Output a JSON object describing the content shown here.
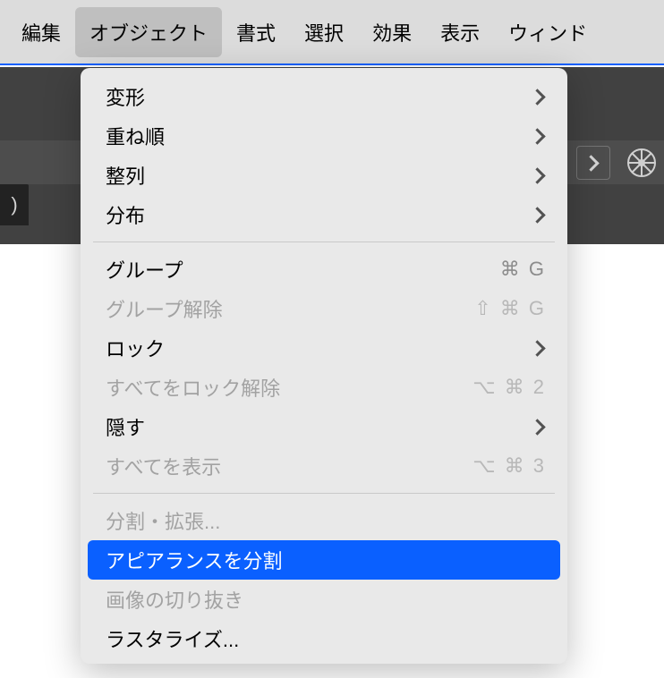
{
  "menubar": {
    "items": [
      {
        "label": "編集"
      },
      {
        "label": "オブジェクト"
      },
      {
        "label": "書式"
      },
      {
        "label": "選択"
      },
      {
        "label": "効果"
      },
      {
        "label": "表示"
      },
      {
        "label": "ウィンド"
      }
    ],
    "active_index": 1
  },
  "tab_fragment": ")",
  "dropdown": {
    "items": [
      {
        "label": "変形",
        "submenu": true
      },
      {
        "label": "重ね順",
        "submenu": true
      },
      {
        "label": "整列",
        "submenu": true
      },
      {
        "label": "分布",
        "submenu": true
      },
      {
        "sep": true
      },
      {
        "label": "グループ",
        "shortcut": "⌘ G"
      },
      {
        "label": "グループ解除",
        "shortcut": "⇧ ⌘ G",
        "disabled": true
      },
      {
        "label": "ロック",
        "submenu": true
      },
      {
        "label": "すべてをロック解除",
        "shortcut": "⌥ ⌘ 2",
        "disabled": true
      },
      {
        "label": "隠す",
        "submenu": true
      },
      {
        "label": "すべてを表示",
        "shortcut": "⌥ ⌘ 3",
        "disabled": true
      },
      {
        "sep": true
      },
      {
        "label": "分割・拡張...",
        "disabled": true
      },
      {
        "label": "アピアランスを分割",
        "highlight": true
      },
      {
        "label": "画像の切り抜き",
        "disabled": true
      },
      {
        "label": "ラスタライズ..."
      }
    ]
  }
}
